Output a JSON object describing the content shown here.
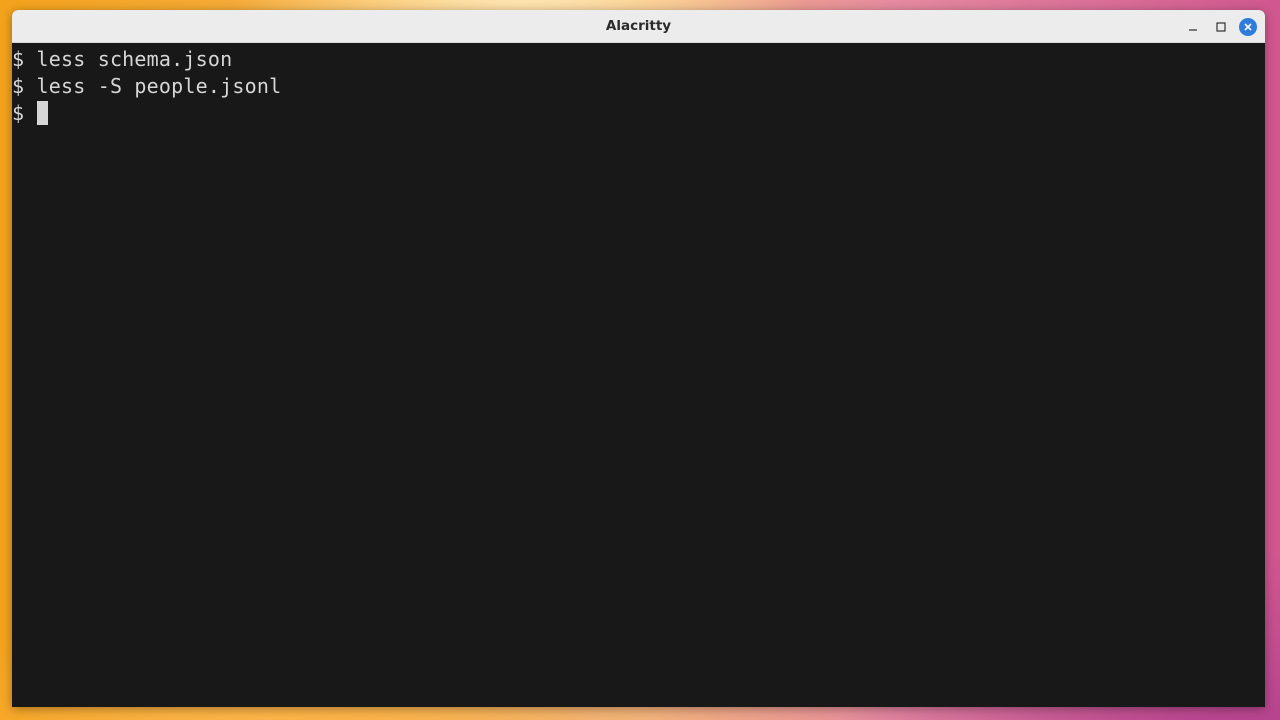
{
  "window": {
    "title": "Alacritty",
    "controls": {
      "minimize_icon": "minimize-icon",
      "maximize_icon": "maximize-icon",
      "close_icon": "close-icon"
    },
    "accent_color": "#2f7ddb",
    "background_color": "#181818"
  },
  "terminal": {
    "lines": [
      {
        "prompt": "$",
        "command": "less schema.json"
      },
      {
        "prompt": "$",
        "command": "less -S people.jsonl"
      },
      {
        "prompt": "$",
        "command": ""
      }
    ]
  }
}
